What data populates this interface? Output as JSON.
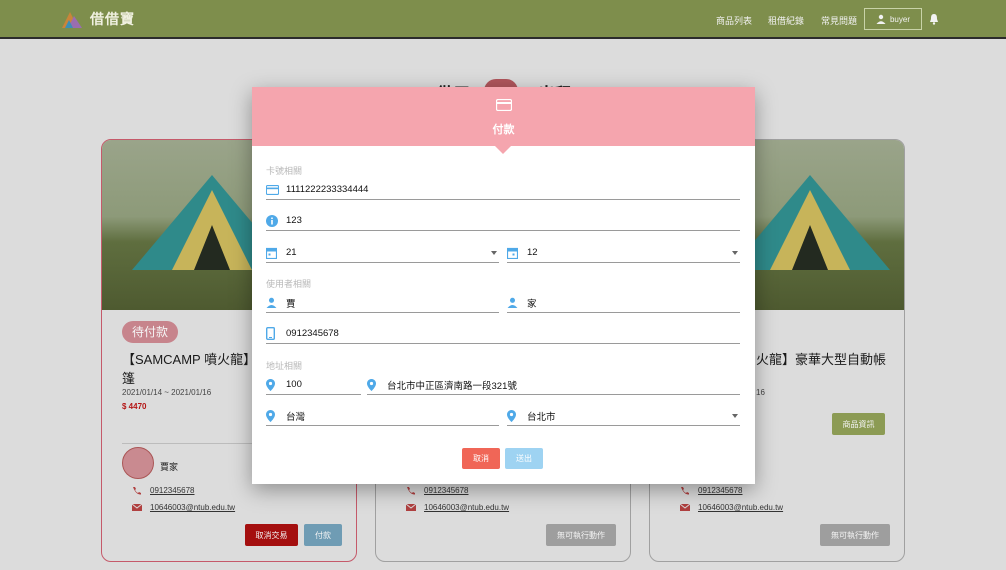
{
  "navbar": {
    "brand": "借借寶",
    "links": [
      "商品列表",
      "租借紀錄",
      "常見問題"
    ],
    "user": "buyer"
  },
  "page": {
    "heading_left": "借用",
    "heading_right": "出租"
  },
  "cards": [
    {
      "status": "待付款",
      "title": "【SAMCAMP 噴火龍】豪華大型自動帳篷",
      "dates": "2021/01/14 ~ 2021/01/16",
      "price": "$ 4470",
      "seller": "賈家",
      "phone": "0912345678",
      "email": "10646003@ntub.edu.tw",
      "btn_cancel": "取消交易",
      "btn_pay": "付款"
    },
    {
      "phone": "0912345678",
      "email": "10646003@ntub.edu.tw",
      "btn_disabled": "無可執行動作"
    },
    {
      "title_partial": "火龍】豪華大型自動帳",
      "dates_partial": "16",
      "btn_info": "商品資訊",
      "phone": "0912345678",
      "email": "10646003@ntub.edu.tw",
      "btn_disabled": "無可執行動作"
    }
  ],
  "modal": {
    "title": "付款",
    "card_section": "卡號相關",
    "card_number": "1111222233334444",
    "cvv": "123",
    "exp_day": "21",
    "exp_month": "12",
    "user_section": "使用者相關",
    "last_name": "賈",
    "first_name": "家",
    "phone": "0912345678",
    "address_section": "地址相關",
    "zip": "100",
    "address": "台北市中正區濟南路一段321號",
    "country": "台灣",
    "city": "台北市",
    "btn_cancel": "取消",
    "btn_submit": "送出"
  },
  "colors": {
    "navbar": "#7e8e4c",
    "modal_header": "#f5a5ae",
    "cancel": "#f06657",
    "submit": "#9ed3f2",
    "field_icon": "#4fa9e8",
    "price": "#b41616"
  }
}
